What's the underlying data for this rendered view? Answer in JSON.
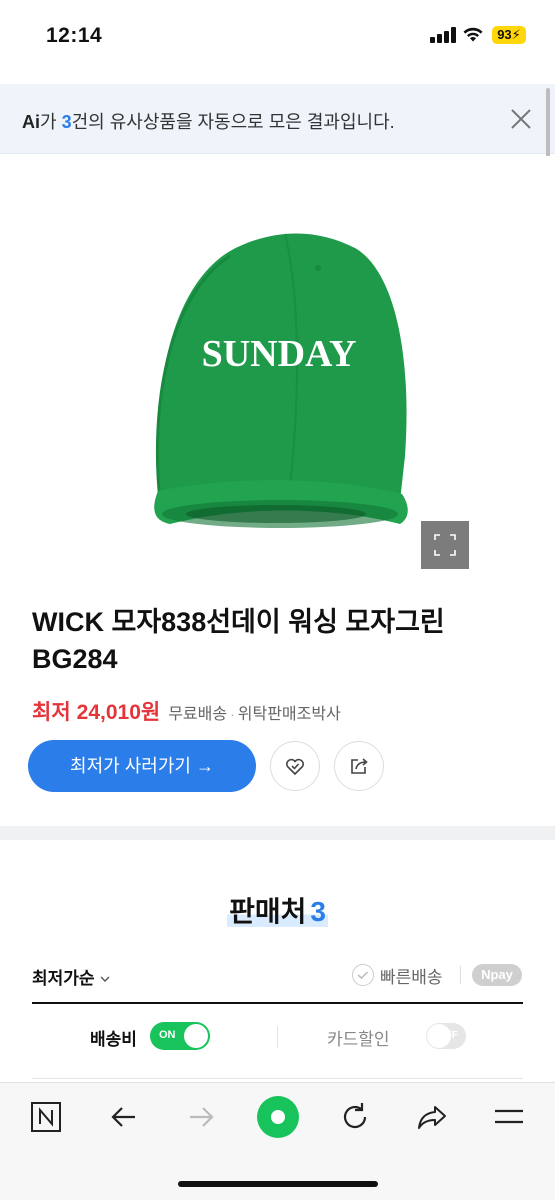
{
  "status_bar": {
    "time": "12:14",
    "battery": "93"
  },
  "ai_banner": {
    "prefix": "가 ",
    "count": "3",
    "message": "건의 유사상품을 자동으로 모은 결과입니다."
  },
  "product": {
    "image_text": "SUNDAY",
    "title": "WICK 모자838선데이 워싱 모자그린 BG284",
    "price_label": "최저",
    "price": "24,010원",
    "shipping": "무료배송",
    "separator": "·",
    "seller": "위탁판매조박사",
    "buy_button": "최저가 사러가기 →"
  },
  "sellers": {
    "title": "판매처",
    "count": "3",
    "sort_label": "최저가순",
    "fast_shipping": "빠른배송",
    "npay": "Npay",
    "shipping_fee_label": "배송비",
    "shipping_toggle": "ON",
    "card_discount_label": "카드할인",
    "card_toggle": "OFF"
  },
  "colors": {
    "accent": "#2b7de9",
    "price": "#e4353b",
    "toggle_on": "#19c35c",
    "nav_green": "#19c35c",
    "cap_green": "#1e9a4a"
  },
  "icons": [
    "signal-icon",
    "wifi-icon",
    "battery-icon",
    "close-icon",
    "expand-icon",
    "heart-icon",
    "share-icon",
    "chevron-down-icon",
    "check-icon",
    "n-home-icon",
    "back-arrow-icon",
    "forward-arrow-icon",
    "green-dot-icon",
    "refresh-icon",
    "share-arrow-icon",
    "menu-icon"
  ]
}
